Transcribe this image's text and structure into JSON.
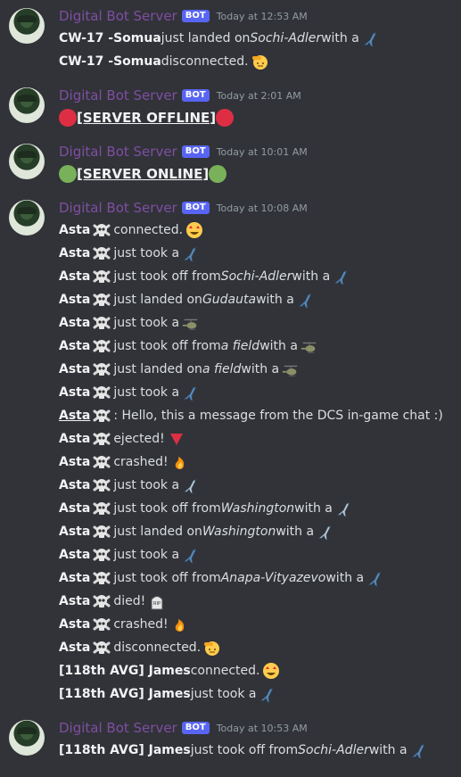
{
  "server_name": "Digital Bot Server",
  "bot_badge": "BOT",
  "groups": [
    {
      "time": "Today at 12:53 AM",
      "lines": [
        {
          "before": "CW-17 -Somua",
          "after": "just landed on",
          "place": "Sochi-Adler",
          "tail": "with a",
          "icon": "jet-icon"
        },
        {
          "before": "CW-17 -Somua",
          "after": "disconnected.",
          "icon": "saluting-face-icon"
        }
      ]
    },
    {
      "time": "Today at 2:01 AM",
      "status": "[SERVER OFFLINE]",
      "status_color": "red"
    },
    {
      "time": "Today at 10:01 AM",
      "status": "[SERVER ONLINE]",
      "status_color": "green"
    },
    {
      "time": "Today at 10:08 AM",
      "lines": [
        {
          "before": "Asta",
          "after": "connected.",
          "icon": "star-struck-icon"
        },
        {
          "before": "Asta",
          "after": "just took a",
          "icon": "jet-icon"
        },
        {
          "before": "Asta",
          "after": "just took off from",
          "place": "Sochi-Adler",
          "tail": "with a",
          "icon": "jet-icon"
        },
        {
          "before": "Asta",
          "after": "just landed on",
          "place": "Gudauta",
          "tail": "with a",
          "icon": "jet-icon"
        },
        {
          "before": "Asta",
          "after": "just took a",
          "icon": "helicopter-icon"
        },
        {
          "before": "Asta",
          "after": "just took off from",
          "place": "a field",
          "tail": "with a",
          "icon": "helicopter-icon"
        },
        {
          "before": "Asta",
          "after": "just landed on",
          "place": "a field",
          "tail": "with a",
          "icon": "helicopter-icon"
        },
        {
          "before": "Asta",
          "after": "just took a",
          "icon": "fighter-icon"
        },
        {
          "before": "Asta",
          "after": ": Hello, this a message from the DCS in-game chat :)",
          "chat": true
        },
        {
          "before": "Asta",
          "after": "ejected!",
          "icon": "red-triangle-icon"
        },
        {
          "before": "Asta",
          "after": "crashed!",
          "icon": "fire-icon"
        },
        {
          "before": "Asta",
          "after": "just took a",
          "icon": "jet-gray-icon"
        },
        {
          "before": "Asta",
          "after": "just took off from",
          "place": "Washington",
          "tail": "with a",
          "icon": "jet-gray-icon"
        },
        {
          "before": "Asta",
          "after": "just landed on",
          "place": "Washington",
          "tail": "with a",
          "icon": "jet-gray-icon"
        },
        {
          "before": "Asta",
          "after": "just took a",
          "icon": "warplane-icon"
        },
        {
          "before": "Asta",
          "after": "just took off from",
          "place": "Anapa-Vityazevo",
          "tail": "with a",
          "icon": "warplane-icon"
        },
        {
          "before": "Asta",
          "after": "died!",
          "icon": "rip-icon"
        },
        {
          "before": "Asta",
          "after": "crashed!",
          "icon": "fire-icon"
        },
        {
          "before": "Asta",
          "after": "disconnected.",
          "icon": "saluting-face-icon"
        },
        {
          "before": "[118th AVG] James",
          "after": "connected.",
          "icon": "star-struck-icon",
          "no_skull": true
        },
        {
          "before": "[118th AVG] James",
          "after": "just took a",
          "icon": "jet-icon",
          "no_skull": true
        }
      ]
    },
    {
      "time": "Today at 10:53 AM",
      "lines": [
        {
          "before": "[118th AVG] James",
          "after": "just took off from",
          "place": "Sochi-Adler",
          "tail": "with a",
          "icon": "jet-icon",
          "no_skull": true
        }
      ]
    }
  ]
}
